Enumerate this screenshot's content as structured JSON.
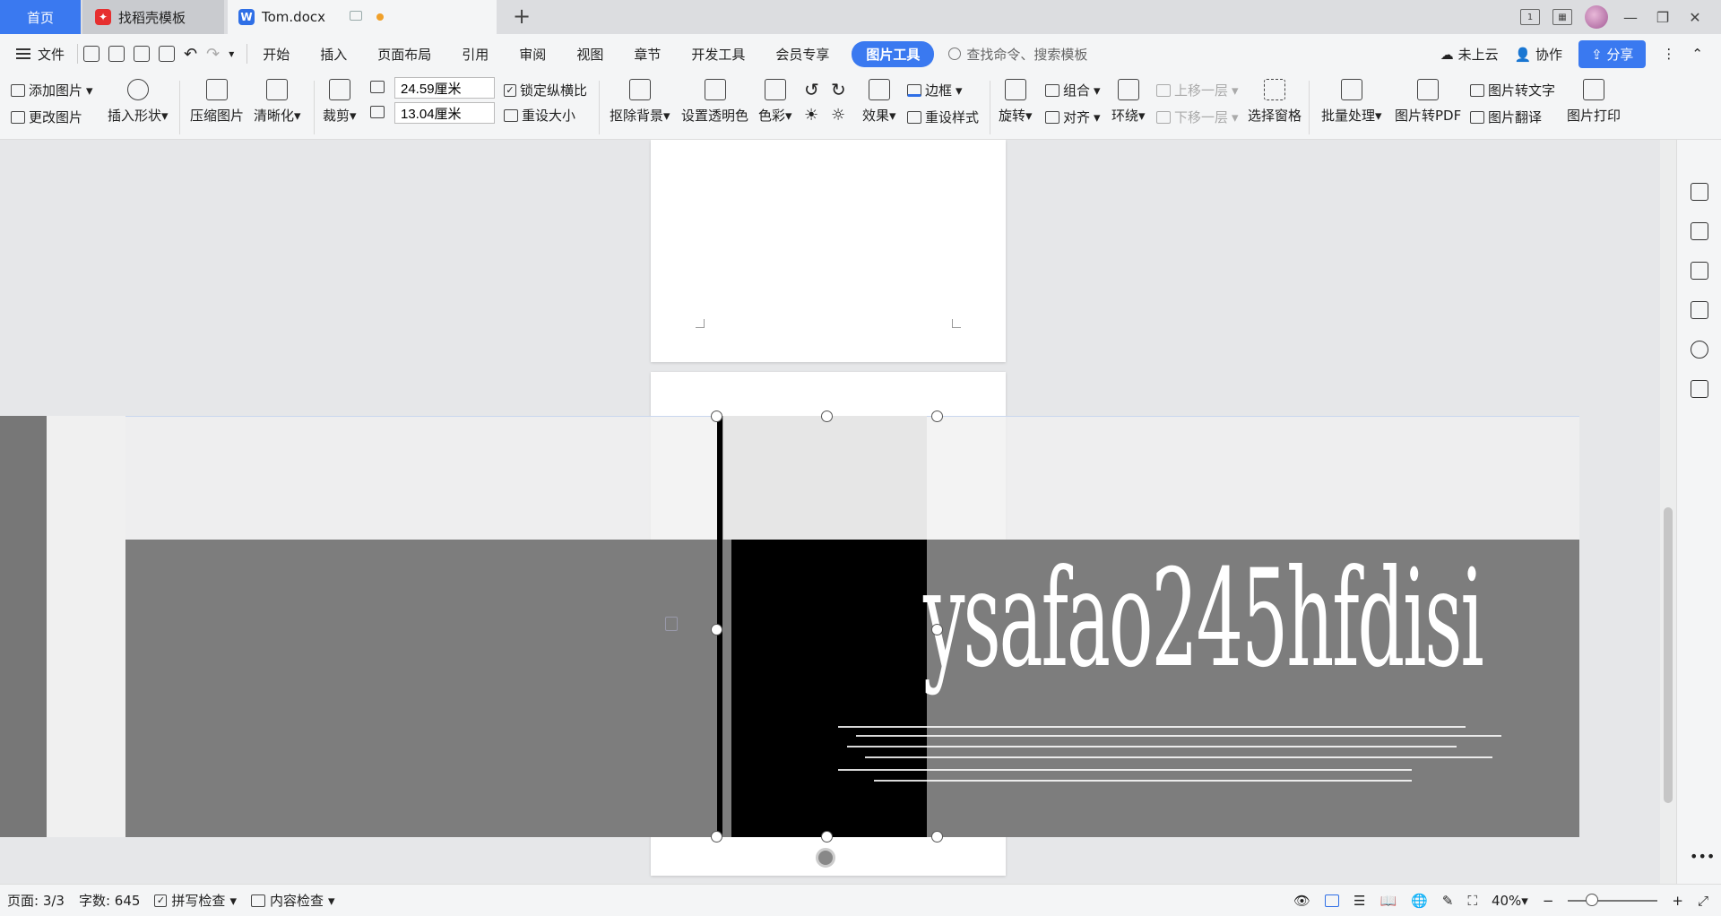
{
  "tabs": {
    "home": "首页",
    "template": "找稻壳模板",
    "doc": "Tom.docx",
    "add": "+"
  },
  "menubar": {
    "file": "文件",
    "items": [
      "开始",
      "插入",
      "页面布局",
      "引用",
      "审阅",
      "视图",
      "章节",
      "开发工具",
      "会员专享"
    ],
    "active": "图片工具",
    "search_placeholder": "查找命令、搜索模板",
    "cloud": "未上云",
    "collab": "协作",
    "share": "分享"
  },
  "ribbon": {
    "add_image": "添加图片",
    "change_image": "更改图片",
    "insert_shape": "插入形状",
    "compress": "压缩图片",
    "sharpen": "清晰化",
    "crop": "裁剪",
    "width": "24.59厘米",
    "height": "13.04厘米",
    "lock_ratio": "锁定纵横比",
    "reset_size": "重设大小",
    "remove_bg": "抠除背景",
    "set_transparent": "设置透明色",
    "color": "色彩",
    "effects": "效果",
    "border": "边框",
    "reset_style": "重设样式",
    "rotate": "旋转",
    "group": "组合",
    "align": "对齐",
    "wrap": "环绕",
    "bring_forward": "上移一层",
    "send_backward": "下移一层",
    "selection_pane": "选择窗格",
    "batch": "批量处理",
    "to_pdf": "图片转PDF",
    "to_text": "图片转文字",
    "translate": "图片翻译",
    "print": "图片打印"
  },
  "canvas": {
    "watermark_text": "ysafao245hfdisi"
  },
  "statusbar": {
    "page": "页面: 3/3",
    "words": "字数: 645",
    "spell": "拼写检查",
    "content": "内容检查",
    "zoom": "40%"
  },
  "colors": {
    "accent": "#3a79f0"
  }
}
